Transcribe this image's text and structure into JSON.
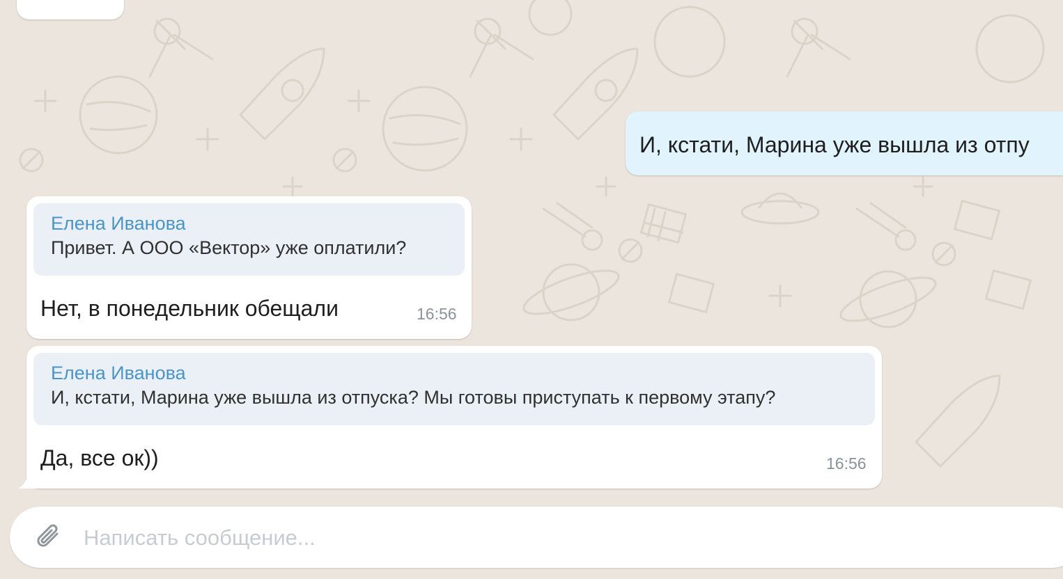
{
  "messages": [
    {
      "direction": "outgoing",
      "text": "И, кстати, Марина уже вышла из отпу"
    },
    {
      "direction": "incoming",
      "reply_to": {
        "author": "Елена Иванова",
        "text": "Привет. А ООО «Вектор» уже оплатили?"
      },
      "text": "Нет, в понедельник обещали",
      "time": "16:56"
    },
    {
      "direction": "incoming",
      "reply_to": {
        "author": "Елена Иванова",
        "text": "И, кстати, Марина уже вышла из отпуска? Мы готовы приступать к первому этапу?"
      },
      "text": "Да, все ок))",
      "time": "16:56"
    }
  ],
  "composer": {
    "placeholder": "Написать сообщение...",
    "value": "",
    "attach_icon": "paperclip-icon"
  },
  "colors": {
    "wallpaper": "#ece5dd",
    "incoming_bubble": "#ffffff",
    "outgoing_bubble": "#e1f3fd",
    "quote_background": "#eaf0f6",
    "quote_author": "#4a95c8",
    "timestamp": "#8a9399",
    "placeholder": "#c6ccd1"
  }
}
